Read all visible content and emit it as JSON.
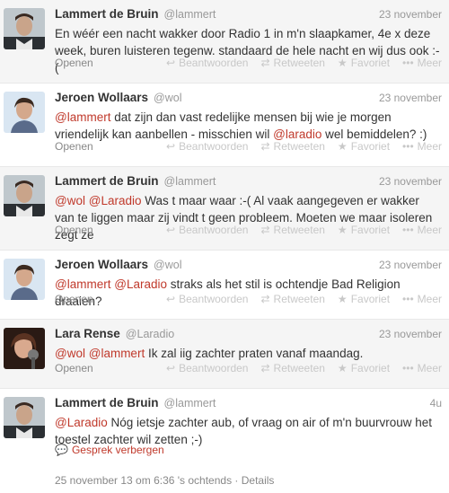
{
  "tweets": [
    {
      "fullname": "Lammert de Bruin",
      "handle": "@lammert",
      "time": "23 november",
      "text_parts": [
        "En wéér een nacht wakker door Radio 1 in m'n slaapkamer, 4e x deze week, buren luisteren tegenw. standaard de hele nacht en wij dus ook :-("
      ]
    },
    {
      "fullname": "Jeroen Wollaars",
      "handle": "@wol",
      "time": "23 november",
      "m1": "@lammert",
      "t1": " dat zijn dan vast redelijke mensen bij wie je morgen vriendelijk kan aanbellen - misschien wil ",
      "m2": "@laradio",
      "t2": " wel bemiddelen? :)"
    },
    {
      "fullname": "Lammert de Bruin",
      "handle": "@lammert",
      "time": "23 november",
      "m1": "@wol",
      "m2": "@Laradio",
      "t1": " Was t maar waar :-( Al vaak aangegeven er wakker van te liggen maar zij vindt t geen probleem. Moeten we maar isoleren zegt ze"
    },
    {
      "fullname": "Jeroen Wollaars",
      "handle": "@wol",
      "time": "23 november",
      "m1": "@lammert",
      "m2": "@Laradio",
      "t1": " straks als het stil is ochtendje Bad Religion draaien?"
    },
    {
      "fullname": "Lara Rense",
      "handle": "@Laradio",
      "time": "23 november",
      "m1": "@wol",
      "m2": "@lammert",
      "t1": " Ik zal iig zachter praten vanaf maandag."
    },
    {
      "fullname": "Lammert de Bruin",
      "handle": "@lammert",
      "time": "4u",
      "m1": "@Laradio",
      "t1": " Nóg ietsje zachter aub, of vraag on air of m'n buurvrouw het toestel zachter wil zetten ;-)"
    }
  ],
  "actions": {
    "open": "Openen",
    "reply": "Beantwoorden",
    "retweet": "Retweeten",
    "favorite": "Favoriet",
    "more": "Meer",
    "hide_conversation": "Gesprek verbergen"
  },
  "footer": "25 november 13 om 6:36 's ochtends · Details",
  "colors": {
    "mention": "#c0392b",
    "muted": "#999999",
    "action_faded": "#c8c8c8",
    "row_bg": "#f5f5f5"
  }
}
